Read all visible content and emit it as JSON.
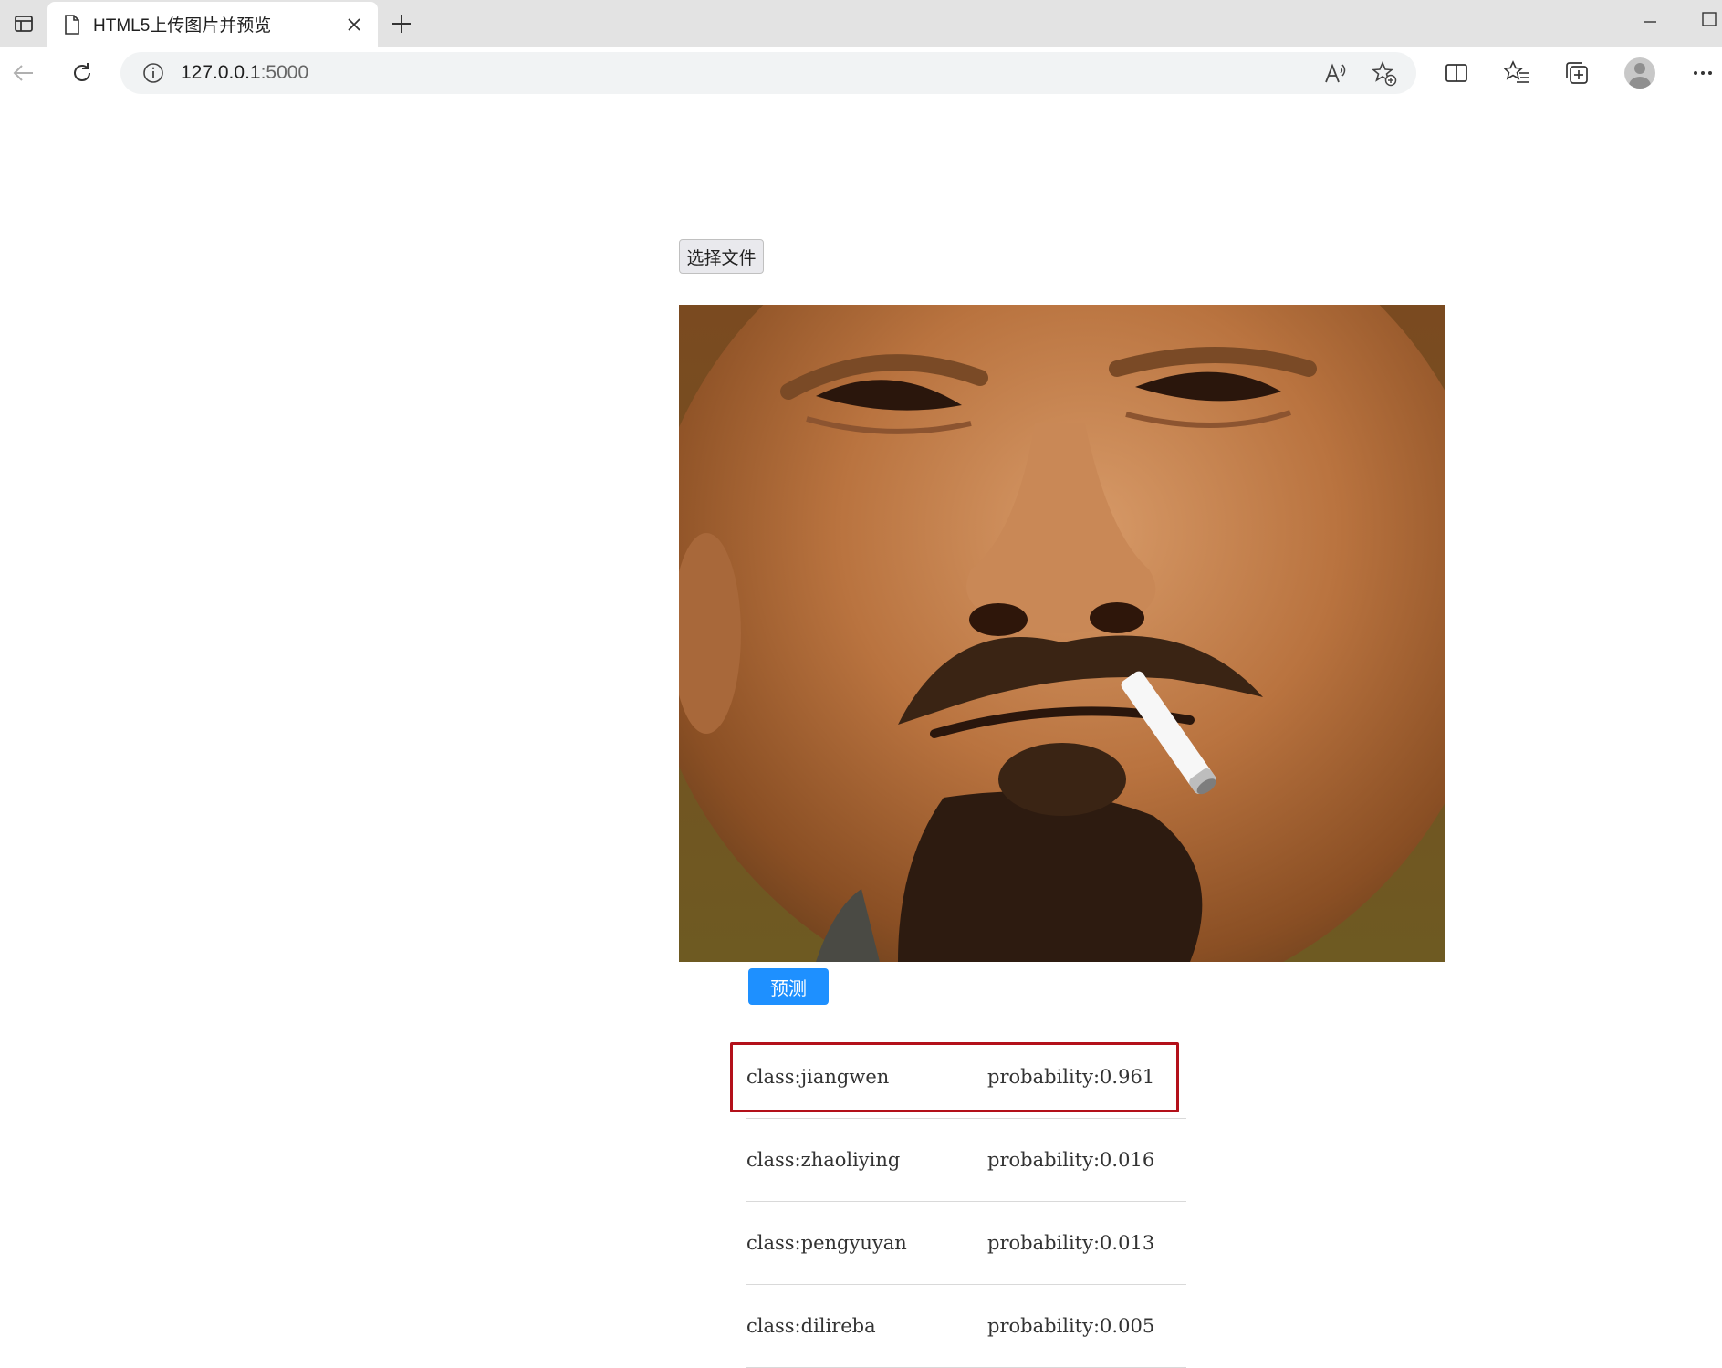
{
  "browser": {
    "tab_title": "HTML5上传图片并预览",
    "url_host": "127.0.0.1",
    "url_port": ":5000"
  },
  "page": {
    "file_button_label": "选择文件",
    "predict_button_label": "预测",
    "results": [
      {
        "class": "class:jiangwen",
        "probability": "probability:0.961"
      },
      {
        "class": "class:zhaoliying",
        "probability": "probability:0.016"
      },
      {
        "class": "class:pengyuyan",
        "probability": "probability:0.013"
      },
      {
        "class": "class:dilireba",
        "probability": "probability:0.005"
      }
    ]
  },
  "colors": {
    "predict_button": "#1e90ff",
    "highlight_border": "#b3101a"
  }
}
